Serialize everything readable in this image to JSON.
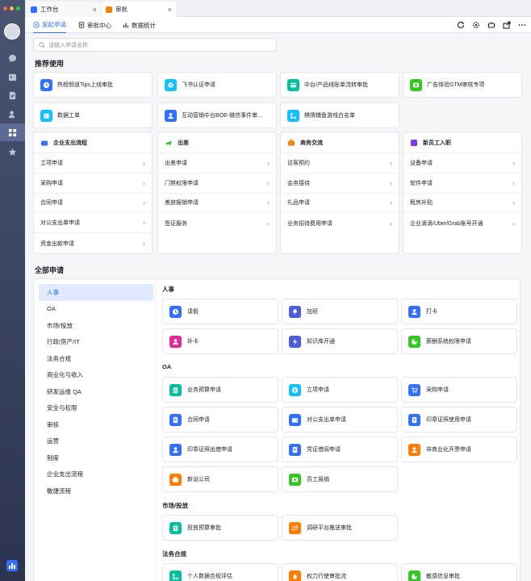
{
  "tabs": [
    {
      "label": "工作台",
      "color": "#3370ff"
    },
    {
      "label": "审批",
      "color": "#ff7d00"
    }
  ],
  "subnav": {
    "items": [
      "发起申请",
      "审批中心",
      "数据统计"
    ]
  },
  "search": {
    "placeholder": "请输入申请名称"
  },
  "recommended": {
    "title": "推荐使用",
    "items": [
      {
        "label": "热榜频道Tips上线审批",
        "color": "#3370ff",
        "icon": "clock-icon"
      },
      {
        "label": "飞书认证申请",
        "color": "#14c0ff",
        "icon": "gear-icon"
      },
      {
        "label": "中台/产品线账单流转审批",
        "color": "#00c0a0",
        "icon": "card-icon"
      },
      {
        "label": "广告体验GTM审核专项",
        "color": "#34c724",
        "icon": "money-icon"
      },
      {
        "label": "数据工单",
        "color": "#14c0ff",
        "icon": "calendar-icon"
      },
      {
        "label": "互动营销中台BOE-微信事件审...",
        "color": "#3370ff",
        "icon": "person-icon"
      },
      {
        "label": "棋牌捕鱼游戏白名单",
        "color": "#14c0ff",
        "icon": "flow-icon"
      }
    ]
  },
  "categories": [
    {
      "title": "企业支出流程",
      "icon": "wallet-icon",
      "color": "#3370ff",
      "items": [
        "立项申请",
        "采购申请",
        "合同申请",
        "对公支出单申请",
        "资金出款申请"
      ]
    },
    {
      "title": "出差",
      "icon": "plane-icon",
      "color": "#34c724",
      "items": [
        "出差申请",
        "门禁权限申请",
        "差旅报销申请",
        "签证服务"
      ]
    },
    {
      "title": "商务交流",
      "icon": "briefcase-icon",
      "color": "#ff7d00",
      "items": [
        "访客预约",
        "会务接待",
        "礼品申请",
        "业务招待费用申请"
      ]
    },
    {
      "title": "新员工入职",
      "icon": "badge-icon",
      "color": "#7f3bf5",
      "items": [
        "设备申请",
        "软件申请",
        "租房补贴",
        "企业滴滴/Uber/Grab账号开通"
      ]
    }
  ],
  "all": {
    "title": "全部申请",
    "nav": [
      "人事",
      "OA",
      "市场/投放",
      "行政/房产/IT",
      "法务合规",
      "商业化与收入",
      "研发运维 QA",
      "安全与权限",
      "审核",
      "运营",
      "制度",
      "企业支出流程",
      "敏捷流程"
    ],
    "groups": [
      {
        "title": "人事",
        "items": [
          {
            "label": "请假",
            "color": "#3370ff",
            "icon": "clock-icon"
          },
          {
            "label": "加班",
            "color": "#4e5dd8",
            "icon": "lamp-icon"
          },
          {
            "label": "打卡",
            "color": "#3370ff",
            "icon": "person-icon"
          },
          {
            "label": "补卡",
            "color": "#e5299a",
            "icon": "person-icon"
          },
          {
            "label": "知识库开通",
            "color": "#4e5dd8",
            "icon": "bolt-icon"
          },
          {
            "label": "薪酬系统权限申请",
            "color": "#34c724",
            "icon": "pie-icon"
          }
        ]
      },
      {
        "title": "OA",
        "items": [
          {
            "label": "业务预算申请",
            "color": "#00c0a0",
            "icon": "clipboard-icon"
          },
          {
            "label": "立项申请",
            "color": "#14c0ff",
            "icon": "yen-icon"
          },
          {
            "label": "采购申请",
            "color": "#3370ff",
            "icon": "cart-icon"
          },
          {
            "label": "合同申请",
            "color": "#3370ff",
            "icon": "doc-icon"
          },
          {
            "label": "对公支出单申请",
            "color": "#3370ff",
            "icon": "wallet-icon"
          },
          {
            "label": "印章证照使用申请",
            "color": "#3370ff",
            "icon": "doc-icon"
          },
          {
            "label": "印章证照出借申请",
            "color": "#3370ff",
            "icon": "person-icon"
          },
          {
            "label": "凭证借阅申请",
            "color": "#3370ff",
            "icon": "doc-icon"
          },
          {
            "label": "非商业化开票申请",
            "color": "#ff7d00",
            "icon": "person-icon"
          },
          {
            "label": "新设公司",
            "color": "#ff7d00",
            "icon": "briefcase-icon"
          },
          {
            "label": "员工报销",
            "color": "#34c724",
            "icon": "money-icon"
          }
        ]
      },
      {
        "title": "市场/投放",
        "items": [
          {
            "label": "投放预算审批",
            "color": "#00c0a0",
            "icon": "clipboard-icon"
          },
          {
            "label": "调研平台推送审批",
            "color": "#ff7d00",
            "icon": "swap-icon"
          }
        ]
      },
      {
        "title": "法务合规",
        "items": [
          {
            "label": "个人数据合规评估",
            "color": "#00c0a0",
            "icon": "flow-icon"
          },
          {
            "label": "权力行使审批流",
            "color": "#ff7d00",
            "icon": "bell-icon"
          },
          {
            "label": "敏感信息审批",
            "color": "#34c724",
            "icon": "pie-icon"
          }
        ]
      }
    ]
  }
}
